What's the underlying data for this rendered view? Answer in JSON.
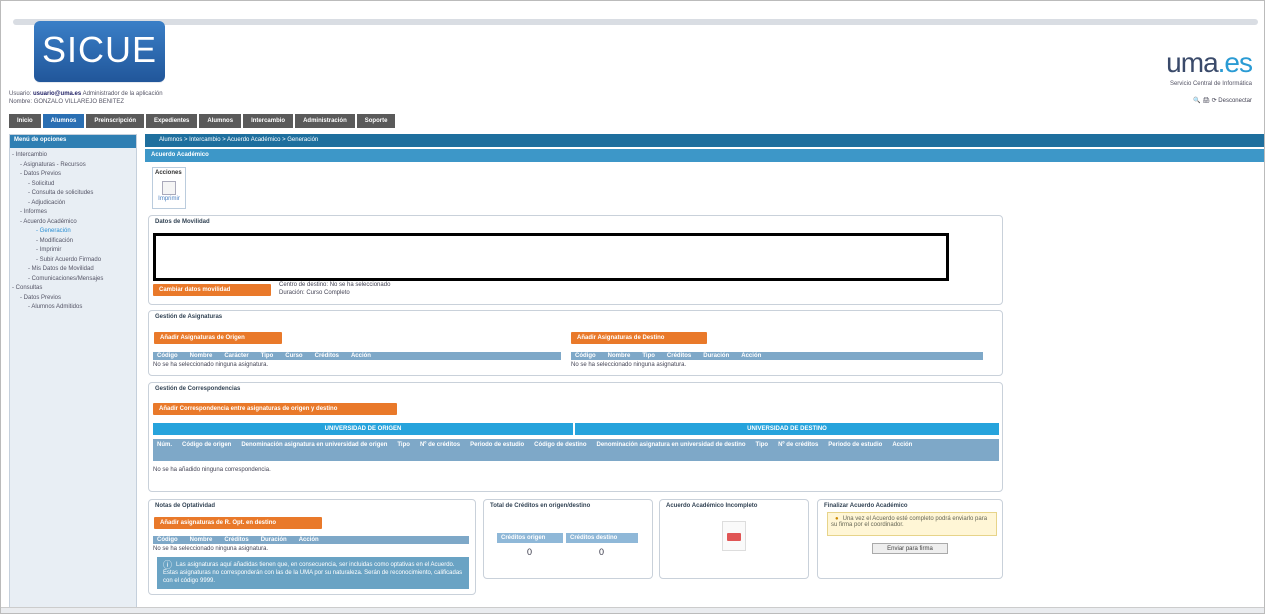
{
  "app": {
    "logo": "SICUE",
    "brand_left": "uma",
    "brand_right": ".es",
    "brand_sub": "Servicio Central de Informática",
    "topright": "🔍 🖨 ⟳ Desconectar"
  },
  "user": {
    "usuario_label": "Usuario:",
    "usuario_email": "usuario@uma.es",
    "usuario_role": "Administrador de la aplicación",
    "nombre_label": "Nombre:",
    "nombre": "GONZALO VILLAREJO BENITEZ"
  },
  "menu": [
    "Inicio",
    "Alumnos",
    "Preinscripción",
    "Expedientes",
    "Alumnos",
    "Intercambio",
    "Administración",
    "Soporte"
  ],
  "sidebar": {
    "title": "Menú de opciones",
    "items": [
      {
        "l": 0,
        "t": "- Intercambio"
      },
      {
        "l": 1,
        "t": "- Asignaturas - Recursos"
      },
      {
        "l": 1,
        "t": "- Datos Previos"
      },
      {
        "l": 2,
        "t": "- Solicitud"
      },
      {
        "l": 2,
        "t": "- Consulta de solicitudes"
      },
      {
        "l": 2,
        "t": "- Adjudicación"
      },
      {
        "l": 1,
        "t": "- Informes"
      },
      {
        "l": 1,
        "t": "- Acuerdo Académico"
      },
      {
        "l": 3,
        "t": "- Generación",
        "sel": true
      },
      {
        "l": 3,
        "t": "- Modificación"
      },
      {
        "l": 3,
        "t": "- Imprimir"
      },
      {
        "l": 3,
        "t": "- Subir Acuerdo Firmado"
      },
      {
        "l": 2,
        "t": "- Mis Datos de Movilidad"
      },
      {
        "l": 2,
        "t": "- Comunicaciones/Mensajes"
      },
      {
        "l": 0,
        "t": "- Consultas"
      },
      {
        "l": 1,
        "t": "- Datos Previos"
      },
      {
        "l": 2,
        "t": "- Alumnos Admitidos"
      }
    ]
  },
  "crumb": "Alumnos > Intercambio > Acuerdo Académico > Generación",
  "subtitle": "Acuerdo Académico",
  "acciones": {
    "title": "Acciones",
    "label": "Imprimir"
  },
  "movilidad": {
    "title": "Datos de Movilidad",
    "btn": "Cambiar datos movilidad",
    "centro": "Centro de destino: No se ha seleccionado",
    "duracion": "Duración: Curso Completo"
  },
  "gestion": {
    "title": "Gestión de Asignaturas",
    "btn_origen": "Añadir Asignaturas de Origen",
    "btn_destino": "Añadir Asignaturas de Destino",
    "cols_origen": [
      "Código",
      "Nombre",
      "Carácter",
      "Tipo",
      "Curso",
      "Créditos",
      "Acción"
    ],
    "cols_destino": [
      "Código",
      "Nombre",
      "Tipo",
      "Créditos",
      "Duración",
      "Acción"
    ],
    "empty": "No se ha seleccionado ninguna asignatura."
  },
  "corr": {
    "title": "Gestión de Correspondencias",
    "btn": "Añadir Correspondencia entre asignaturas de origen y destino",
    "origen": "UNIVERSIDAD DE ORIGEN",
    "destino": "UNIVERSIDAD DE DESTINO",
    "cols": [
      "Núm.",
      "Código de origen",
      "Denominación asignatura en universidad de origen",
      "Tipo",
      "Nº de créditos",
      "Periodo de estudio",
      "Código de destino",
      "Denominación asignatura en universidad de destino",
      "Tipo",
      "Nº de créditos",
      "Periodo de estudio",
      "Acción"
    ],
    "empty": "No se ha añadido ninguna correspondencia."
  },
  "opt": {
    "title": "Notas de Optatividad",
    "btn": "Añadir asignaturas de R. Opt. en destino",
    "cols": [
      "Código",
      "Nombre",
      "Créditos",
      "Duración",
      "Acción"
    ],
    "empty": "No se ha seleccionado ninguna asignatura.",
    "info": "Las asignaturas aquí añadidas tienen que, en consecuencia, ser incluidas como optativas en el Acuerdo. Estas asignaturas no corresponderán con las de la UMA por su naturaleza. Serán de reconocimiento, calificadas con el código 9999."
  },
  "total": {
    "title": "Total de Créditos en origen/destino",
    "l1": "Créditos origen",
    "l2": "Créditos destino",
    "v1": "0",
    "v2": "0"
  },
  "incompleto": {
    "title": "Acuerdo Académico Incompleto"
  },
  "finalizar": {
    "title": "Finalizar Acuerdo Académico",
    "warn": "Una vez el Acuerdo esté completo podrá enviarlo para su firma por el coordinador.",
    "btn": "Enviar para firma"
  }
}
